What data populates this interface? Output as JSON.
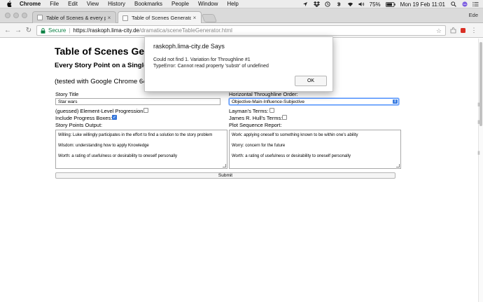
{
  "menubar": {
    "items": [
      "Chrome",
      "File",
      "Edit",
      "View",
      "History",
      "Bookmarks",
      "People",
      "Window",
      "Help"
    ],
    "battery": "75%",
    "datetime": "Mon 19 Feb  11:01"
  },
  "tabs": [
    {
      "label": "Table of Scenes & every possi",
      "close": "×"
    },
    {
      "label": "Table of Scenes Generator",
      "close": "×"
    }
  ],
  "user_name": "Ede",
  "address": {
    "secure_label": "Secure",
    "host": "https://raskoph.lima-city.de",
    "path": "/dramatica/sceneTableGenerator.html"
  },
  "page": {
    "title": "Table of Scenes Gene",
    "subtitle": "Every Story Point on a Single P",
    "note": "(tested with Google Chrome 64.0."
  },
  "form": {
    "story_title_label": "Story Title",
    "story_title_value": "Star wars",
    "throughline_order_label": "Horizontal Throughline Order:",
    "throughline_order_value": "Objective-Main-Influence-Subjective",
    "element_progression_label": "(guessed) Element-Level Progression:",
    "laymans_label": "Layman's Terms:",
    "progress_boxes_label": "Include Progress Boxes:",
    "hulls_label": "James R. Hull's Terms:",
    "story_points_label": "Story Points Output:",
    "plot_sequence_label": "Plot Sequence Report:",
    "story_points_lines": [
      "Willing:  Luke willingly participates in the effort to find a solution to the story problem",
      "Wisdom:  understanding how to apply Knowledge",
      "Worth:  a rating of usefulness or desirability to oneself personally"
    ],
    "plot_sequence_lines": [
      "Work:  applying oneself to something known to be within one's ability",
      "Worry:  concern for the future",
      "Worth:  a rating of usefulness or desirability to oneself personally"
    ],
    "submit_label": "Submit"
  },
  "dialog": {
    "title": "raskoph.lima-city.de Says",
    "line1": "Could not find 1. Variation for Throughline #1",
    "line2": "TypeError: Cannot read property 'substr' of undefined",
    "ok_label": "OK"
  }
}
